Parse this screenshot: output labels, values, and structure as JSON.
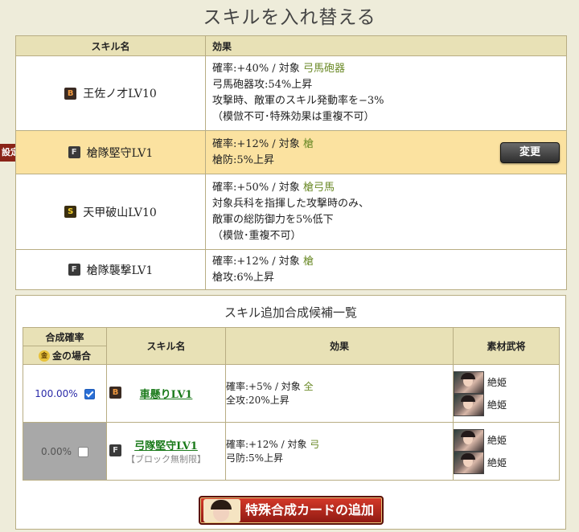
{
  "page": {
    "title": "スキルを入れ替える"
  },
  "set_marker": "設定中",
  "skill_table": {
    "headers": {
      "name": "スキル名",
      "effect": "効果"
    },
    "rows": [
      {
        "rank": "B",
        "name": "王佐ノ才LV10",
        "eff1_pre": "確率:+40% / 対象 ",
        "target": "弓馬砲器",
        "lines": [
          "弓馬砲器攻:54%上昇",
          "攻撃時、敵軍のスキル発動率を−3%",
          "（模倣不可･特殊効果は重複不可）"
        ]
      },
      {
        "rank": "F",
        "name": "槍隊堅守LV1",
        "eff1_pre": "確率:+12% / 対象 ",
        "target": "槍",
        "lines": [
          "槍防:5%上昇"
        ],
        "button": "変更"
      },
      {
        "rank": "S",
        "name": "天甲破山LV10",
        "eff1_pre": "確率:+50% / 対象 ",
        "target": "槍弓馬",
        "lines": [
          "対象兵科を指揮した攻撃時のみ、",
          "敵軍の総防御力を5%低下",
          "（模倣･重複不可）"
        ]
      },
      {
        "rank": "F",
        "name": "槍隊襲撃LV1",
        "eff1_pre": "確率:+12% / 対象 ",
        "target": "槍",
        "lines": [
          "槍攻:6%上昇"
        ]
      }
    ]
  },
  "candidates": {
    "title": "スキル追加合成候補一覧",
    "headers": {
      "rate": "合成確率",
      "gold_case": "金の場合",
      "coin": "金",
      "name": "スキル名",
      "effect": "効果",
      "material": "素材武将"
    },
    "rows": [
      {
        "rate": "100.00%",
        "checked": true,
        "rank": "B",
        "name": "車懸りLV1",
        "note": "",
        "eff1_pre": "確率:+5% / 対象 ",
        "target": "全",
        "eff2": "全攻:20%上昇",
        "materials": [
          "絶姫",
          "絶姫"
        ]
      },
      {
        "rate": "0.00%",
        "checked": false,
        "rank": "F",
        "name": "弓隊堅守LV1",
        "note": "【ブロック無制限】",
        "eff1_pre": "確率:+12% / 対象 ",
        "target": "弓",
        "eff2": "弓防:5%上昇",
        "materials": [
          "絶姫",
          "絶姫"
        ]
      }
    ]
  },
  "add_card_button": "特殊合成カードの追加",
  "colors": {
    "accent_green": "#6b8a28",
    "selected_row": "#fbe2a0",
    "header_bg": "#e8e1b6"
  }
}
